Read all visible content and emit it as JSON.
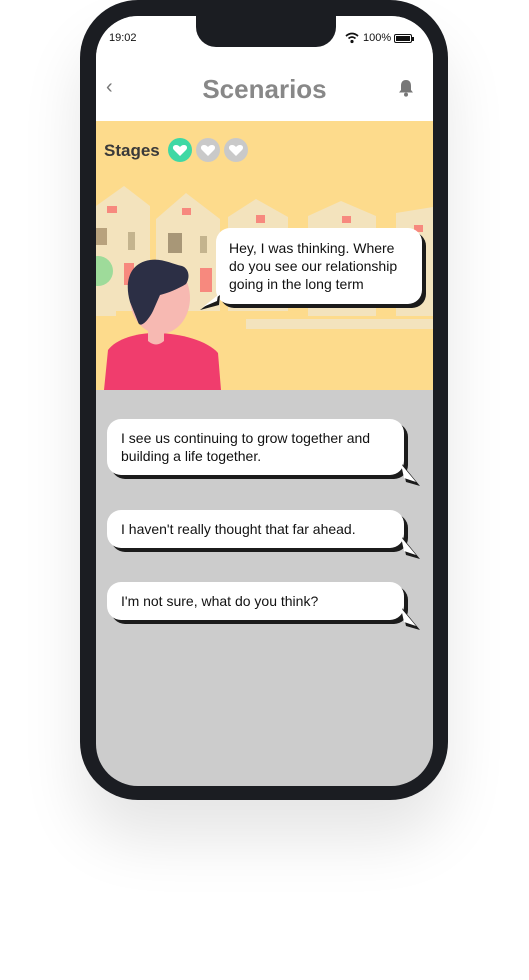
{
  "status": {
    "time": "19:02",
    "battery": "100%"
  },
  "nav": {
    "back": "‹",
    "title": "Scenarios",
    "back_icon": "chevron-left-icon",
    "bell_icon": "bell-icon"
  },
  "stages": {
    "label": "Stages",
    "icons": [
      "heart-icon-active",
      "heart-icon",
      "heart-icon"
    ],
    "active_color": "#3fd8a4",
    "inactive_color": "#c9c9c9"
  },
  "scene": {
    "background_color": "#fddb8c",
    "speech": "Hey, I was thinking. Where do you see our relationship going in the long term"
  },
  "choices": [
    {
      "text": "I see us continuing to grow together and building a life together."
    },
    {
      "text": "I haven't really thought that far ahead."
    },
    {
      "text": "I'm not sure, what do you think?"
    }
  ],
  "colors": {
    "shirt": "#f03d6d",
    "hair": "#2c2f45",
    "skin": "#f7b9b2",
    "answers_bg": "#cccccc",
    "phone_frame": "#1b1d22"
  }
}
